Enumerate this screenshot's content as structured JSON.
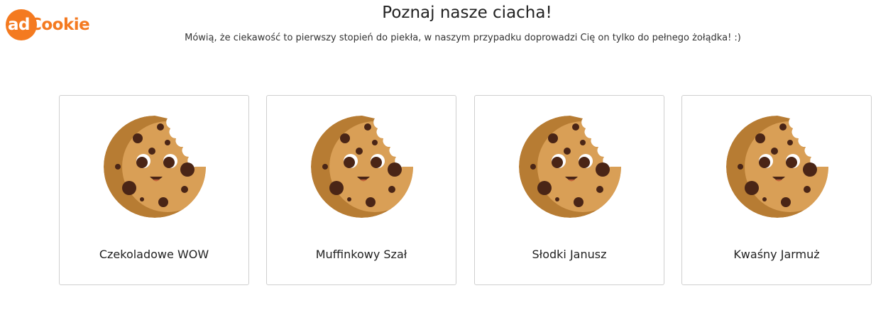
{
  "logo": {
    "part1": "ad",
    "part2": "Cookie",
    "accent": "#f47a20"
  },
  "header": {
    "title": "Poznaj nasze ciacha!",
    "subtitle": "Mówią, że ciekawość to pierwszy stopień do piekła, w naszym przypadku doprowadzi Cię on tylko do pełnego żołądka! :)"
  },
  "cookies": [
    {
      "label": "Czekoladowe WOW",
      "icon": "smiling-cookie-icon"
    },
    {
      "label": "Muffinkowy Szał",
      "icon": "smiling-cookie-icon"
    },
    {
      "label": "Słodki Janusz",
      "icon": "smiling-cookie-icon"
    },
    {
      "label": "Kwaśny Jarmuż",
      "icon": "smiling-cookie-icon"
    }
  ]
}
